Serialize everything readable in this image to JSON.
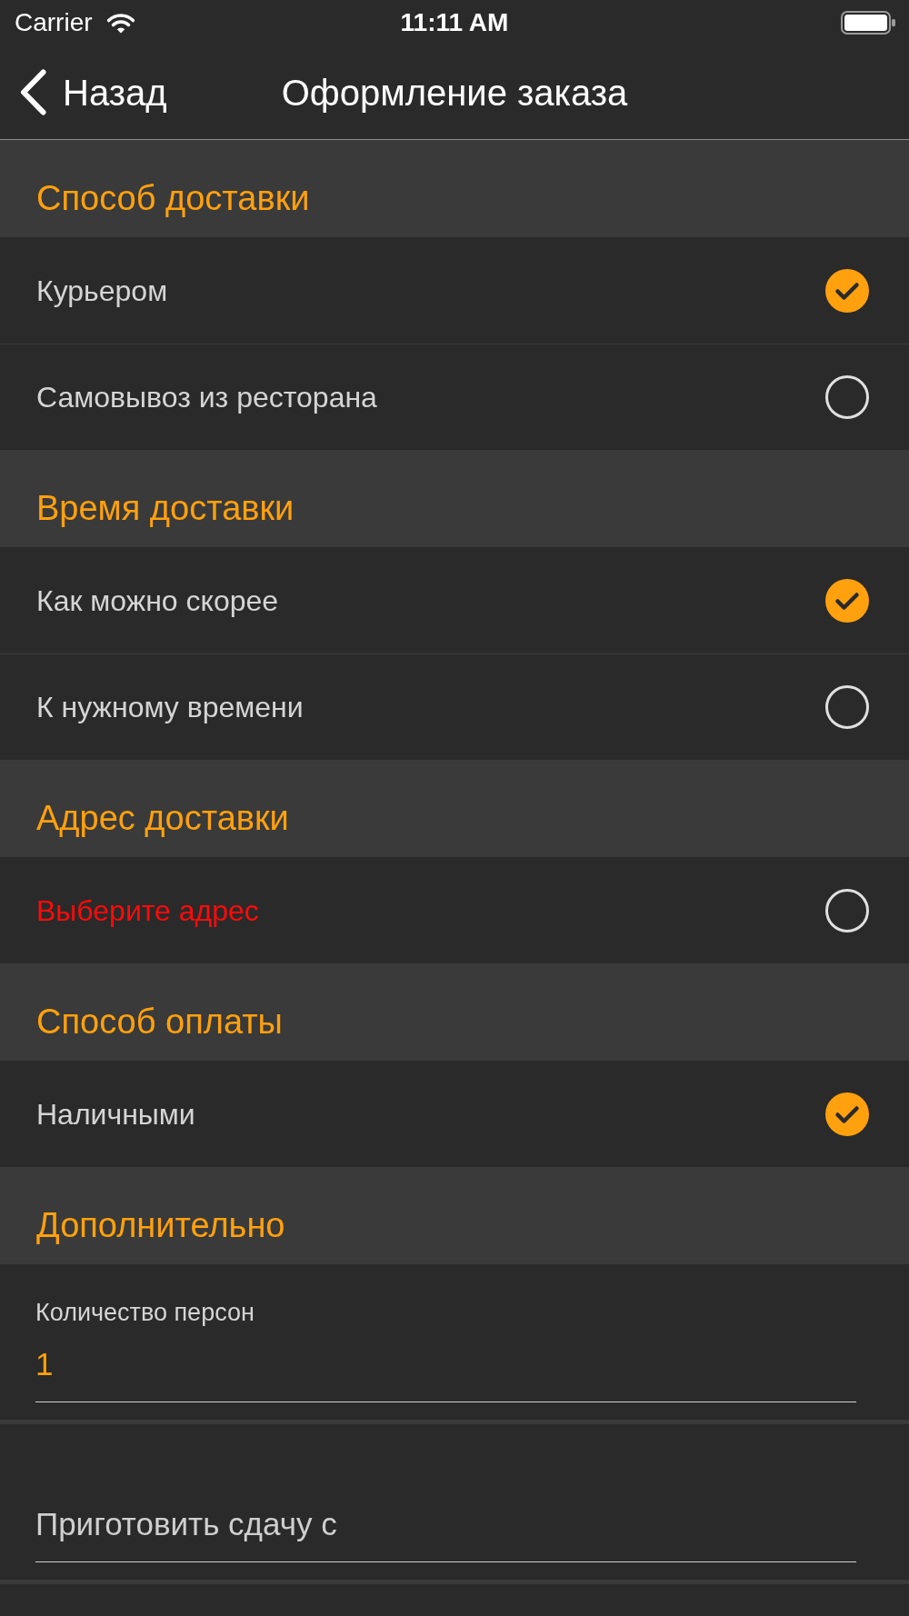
{
  "status_bar": {
    "carrier": "Carrier",
    "time": "11:11 AM"
  },
  "nav_bar": {
    "back_label": "Назад",
    "title": "Оформление заказа"
  },
  "sections": [
    {
      "kind": "options",
      "title": "Способ доставки",
      "options": [
        {
          "label": "Курьером",
          "kind": "choice",
          "selected": true
        },
        {
          "label": "Самовывоз из ресторана",
          "kind": "choice",
          "selected": false
        }
      ]
    },
    {
      "kind": "options",
      "title": "Время доставки",
      "options": [
        {
          "label": "Как можно скорее",
          "kind": "choice",
          "selected": true
        },
        {
          "label": "К нужному времени",
          "kind": "choice",
          "selected": false
        }
      ]
    },
    {
      "kind": "options",
      "title": "Адрес доставки",
      "options": [
        {
          "label": "Выберите адрес",
          "kind": "prompt",
          "selected": false
        }
      ]
    },
    {
      "kind": "options",
      "title": "Способ оплаты",
      "options": [
        {
          "label": "Наличными",
          "kind": "choice",
          "selected": true
        }
      ]
    },
    {
      "kind": "fields",
      "title": "Дополнительно",
      "fields": [
        {
          "label": "Количество персон",
          "value": "1"
        },
        {
          "placeholder": "Приготовить сдачу с"
        }
      ]
    }
  ]
}
